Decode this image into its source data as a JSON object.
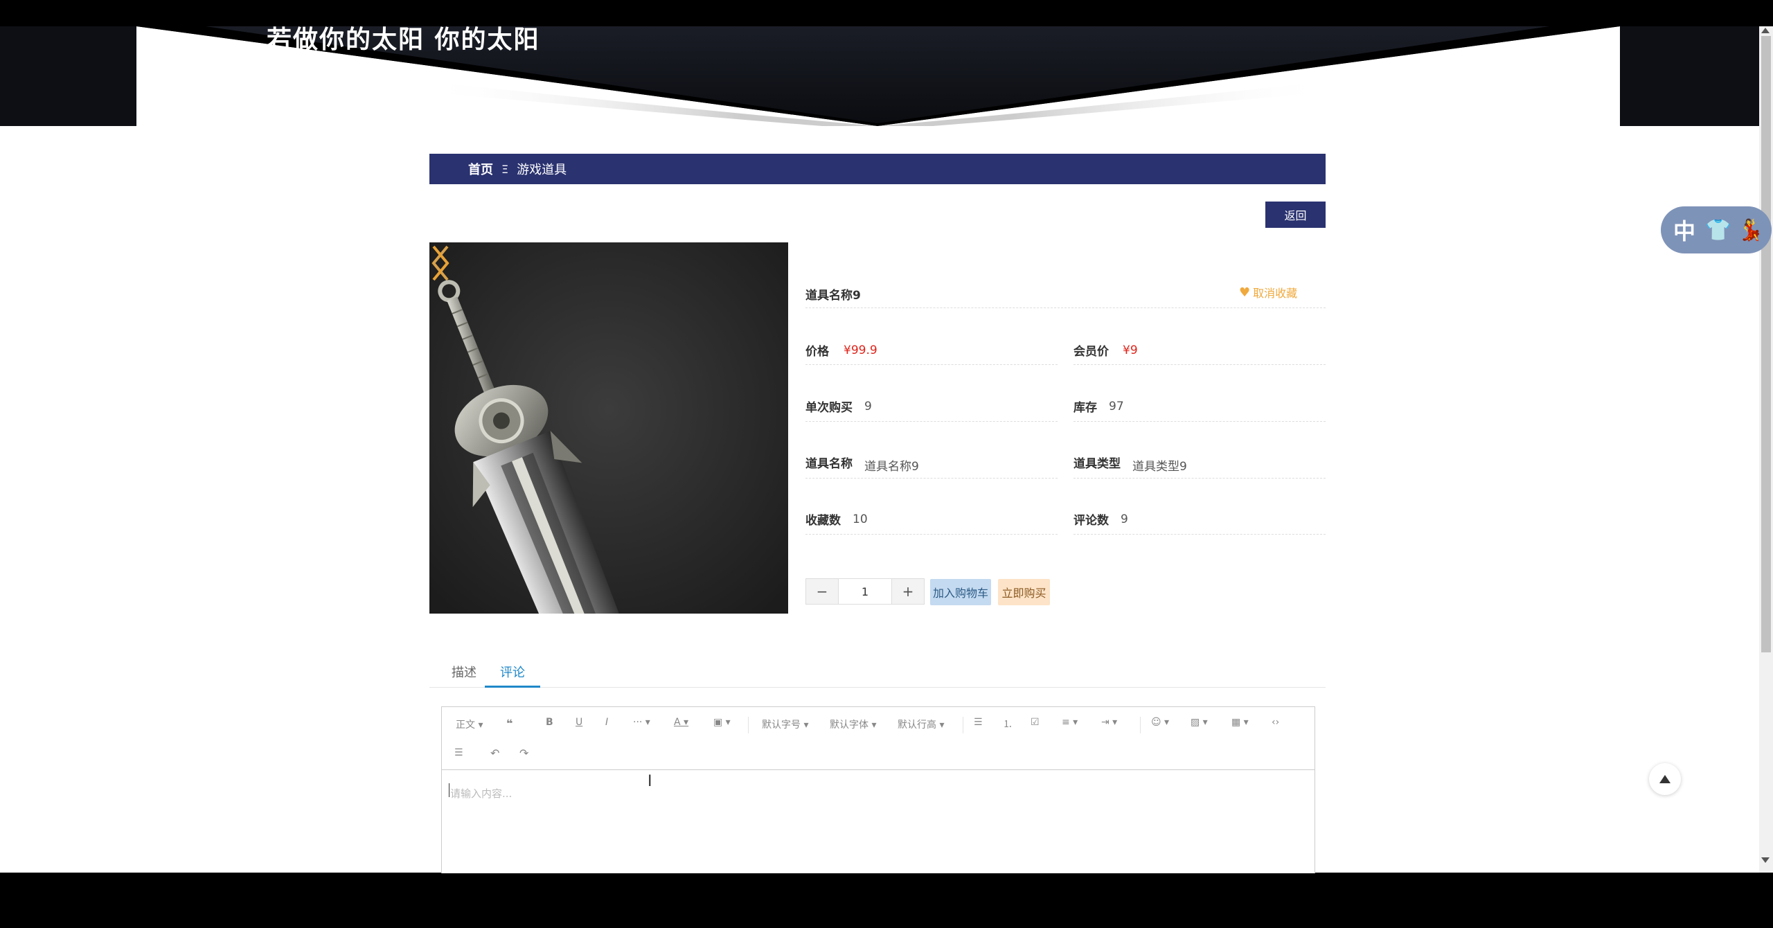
{
  "banner": {
    "text": "若做你的太阳 你的太阳"
  },
  "breadcrumb": {
    "home": "首页",
    "separator": "Ξ",
    "current": "游戏道具"
  },
  "back_button": "返回",
  "product": {
    "name": "道具名称9",
    "favorite_label": "取消收藏",
    "fields": [
      {
        "label": "价格",
        "value": "¥99.9",
        "highlight": true
      },
      {
        "label": "会员价",
        "value": "¥9",
        "highlight": true
      },
      {
        "label": "单次购买",
        "value": "9"
      },
      {
        "label": "库存",
        "value": "97"
      },
      {
        "label": "道具名称",
        "value": "道具名称9"
      },
      {
        "label": "道具类型",
        "value": "道具类型9"
      },
      {
        "label": "收藏数",
        "value": "10"
      },
      {
        "label": "评论数",
        "value": "9"
      }
    ]
  },
  "purchase": {
    "minus": "−",
    "quantity": "1",
    "plus": "+",
    "add_to_cart": "加入购物车",
    "buy_now": "立即购买"
  },
  "tabs": {
    "description": "描述",
    "comments": "评论",
    "active": "comments"
  },
  "editor": {
    "toolbar": {
      "paragraph": "正文",
      "font_size": "默认字号",
      "font_family": "默认字体",
      "line_height": "默认行高"
    },
    "placeholder": "请输入内容..."
  },
  "ime": {
    "lang": "中"
  },
  "colors": {
    "nav": "#2a3270",
    "price": "#e0241b",
    "favorite": "#f0a93d",
    "tab_active": "#1e88c9"
  }
}
